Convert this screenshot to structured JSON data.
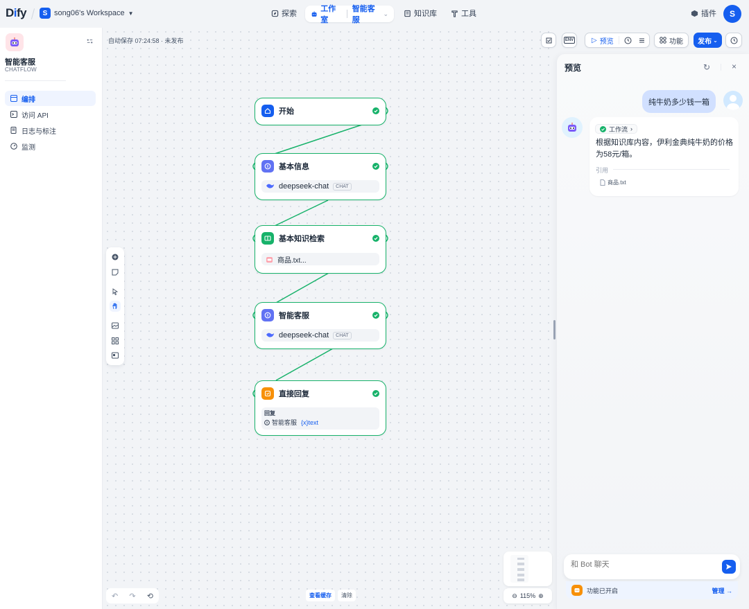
{
  "topnav": {
    "logo": "Dify",
    "workspace_initial": "S",
    "workspace_name": "song06's Workspace",
    "explore": "探索",
    "studio": "工作室",
    "current_app": "智能客服",
    "knowledge": "知识库",
    "tools": "工具",
    "plugins": "插件",
    "user_initial": "S"
  },
  "sidebar": {
    "app_name": "智能客服",
    "app_type": "CHATFLOW",
    "items": [
      {
        "label": "编排",
        "active": true
      },
      {
        "label": "访问 API",
        "active": false
      },
      {
        "label": "日志与标注",
        "active": false
      },
      {
        "label": "监测",
        "active": false
      }
    ]
  },
  "canvas": {
    "autosave": "自动保存 07:24:58 · 未发布",
    "zoom": "115%",
    "view_cache": "查看缓存",
    "clear": "清除"
  },
  "toolbar": {
    "env": "ENV",
    "preview": "预览",
    "features": "功能",
    "publish": "发布"
  },
  "nodes": [
    {
      "title": "开始",
      "color": "#155eef"
    },
    {
      "title": "基本信息",
      "color": "#6172f3",
      "model": "deepseek-chat",
      "chip": "CHAT"
    },
    {
      "title": "基本知识检索",
      "color": "#17b26a",
      "dataset": "商品.txt..."
    },
    {
      "title": "智能客服",
      "color": "#6172f3",
      "model": "deepseek-chat",
      "chip": "CHAT"
    },
    {
      "title": "直接回复",
      "color": "#f79009",
      "reply_label": "回复",
      "var_node": "智能客服",
      "var_name": "{x}text"
    }
  ],
  "preview": {
    "title": "预览",
    "user_message": "纯牛奶多少钱一箱",
    "workflow_label": "工作流",
    "answer": "根据知识库内容，伊利金典纯牛奶的价格为58元/箱。",
    "citation_label": "引用",
    "citation_file": "商品.txt",
    "input_placeholder": "和 Bot 聊天",
    "features_enabled": "功能已开启",
    "manage": "管理 →"
  }
}
